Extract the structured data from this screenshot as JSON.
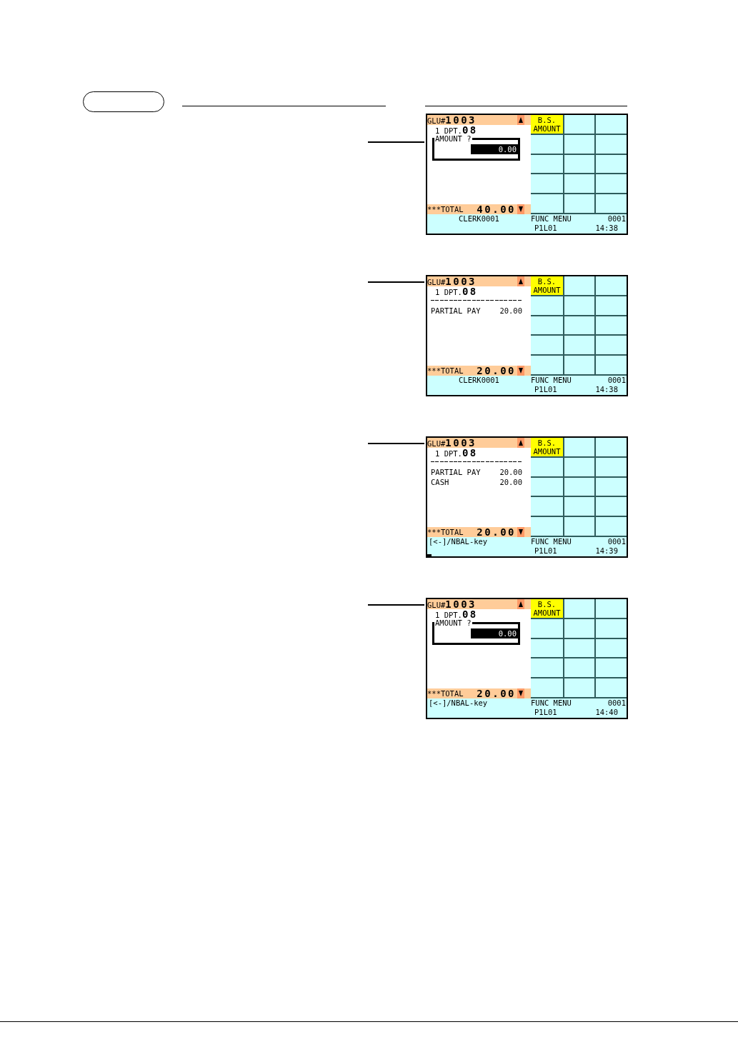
{
  "screens": [
    {
      "guest_check": "GLU#**1003**",
      "item": "1 DPT.**08**",
      "body": [
        {
          "kind": "prompt",
          "label": "AMOUNT ?",
          "value": "0.00"
        }
      ],
      "total": {
        "label": "***TOTAL",
        "amount": "40.00"
      },
      "keys": [
        {
          "label": "B.S. AMOUNT"
        }
      ],
      "status": {
        "message": {
          "kind": "clerk",
          "text": "CLERK0001"
        },
        "menu": "FUNC MENU",
        "count": "0001",
        "page": "P1L01",
        "time": "14:38"
      },
      "cursor": false
    },
    {
      "guest_check": "GLU#**1003**",
      "item": "1 DPT.**08**",
      "body": [
        {
          "kind": "separator"
        },
        {
          "kind": "line",
          "label": "PARTIAL PAY",
          "amount": "20.00"
        }
      ],
      "total": {
        "label": "***TOTAL",
        "amount": "20.00"
      },
      "keys": [
        {
          "label": "B.S. AMOUNT"
        }
      ],
      "status": {
        "message": {
          "kind": "clerk",
          "text": "CLERK0001"
        },
        "menu": "FUNC MENU",
        "count": "0001",
        "page": "P1L01",
        "time": "14:38"
      },
      "cursor": false
    },
    {
      "guest_check": "GLU#**1003**",
      "item": "1 DPT.**08**",
      "body": [
        {
          "kind": "separator"
        },
        {
          "kind": "line",
          "label": "PARTIAL PAY",
          "amount": "20.00"
        },
        {
          "kind": "line",
          "label": "CASH",
          "amount": "20.00"
        }
      ],
      "total": {
        "label": "***TOTAL",
        "amount": "20.00"
      },
      "keys": [
        {
          "label": "B.S. AMOUNT"
        }
      ],
      "status": {
        "message": {
          "kind": "hint",
          "text": "[<-]/NBAL-key"
        },
        "menu": "FUNC MENU",
        "count": "0001",
        "page": "P1L01",
        "time": "14:39"
      },
      "cursor": true
    },
    {
      "guest_check": "GLU#**1003**",
      "item": "1 DPT.**08**",
      "body": [
        {
          "kind": "prompt",
          "label": "AMOUNT ?",
          "value": "0.00"
        }
      ],
      "total": {
        "label": "***TOTAL",
        "amount": "20.00"
      },
      "keys": [
        {
          "label": "B.S. AMOUNT"
        }
      ],
      "status": {
        "message": {
          "kind": "hint",
          "text": "[<-]/NBAL-key"
        },
        "menu": "FUNC MENU",
        "count": "0001",
        "page": "P1L01",
        "time": "14:40"
      },
      "cursor": false
    }
  ]
}
